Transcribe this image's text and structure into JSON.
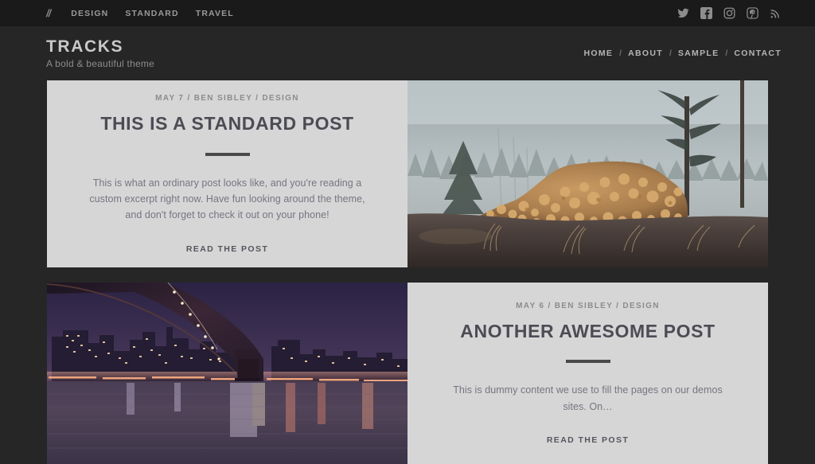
{
  "topbar": {
    "logo_mark": "//",
    "categories": [
      {
        "label": "DESIGN"
      },
      {
        "label": "STANDARD"
      },
      {
        "label": "TRAVEL"
      }
    ],
    "social": [
      {
        "name": "twitter-icon",
        "label": "Twitter"
      },
      {
        "name": "facebook-icon",
        "label": "Facebook"
      },
      {
        "name": "instagram-icon",
        "label": "Instagram"
      },
      {
        "name": "pinterest-icon",
        "label": "Pinterest"
      },
      {
        "name": "rss-icon",
        "label": "RSS"
      }
    ],
    "background": "#1a1a1a"
  },
  "header": {
    "site_title": "TRACKS",
    "tagline": "A bold & beautiful theme",
    "background": "#262626",
    "nav": [
      {
        "label": "HOME"
      },
      {
        "label": "ABOUT"
      },
      {
        "label": "SAMPLE"
      },
      {
        "label": "CONTACT"
      }
    ],
    "nav_separator": "/"
  },
  "posts": [
    {
      "meta": "MAY 7 / BEN SIBLEY / DESIGN",
      "date": "MAY 7",
      "author": "BEN SIBLEY",
      "category": "DESIGN",
      "title": "THIS IS A STANDARD POST",
      "excerpt": "This is what an ordinary post looks like, and you're reading a custom excerpt right now. Have fun looking around the theme, and don't forget to check it out on your phone!",
      "read_more": "READ THE POST",
      "image_alt": "Misty forest clearing with a large pile of cut logs",
      "layout": "text-left"
    },
    {
      "meta": "MAY 6 / BEN SIBLEY / DESIGN",
      "date": "MAY 6",
      "author": "BEN SIBLEY",
      "category": "DESIGN",
      "title": "ANOTHER AWESOME POST",
      "excerpt": "This is dummy content we use to fill the pages on our demos sites. On…",
      "read_more": "READ THE POST",
      "image_alt": "Brooklyn Bridge at night over the river with the city skyline lit up",
      "layout": "image-left"
    }
  ],
  "theme": {
    "page_background": "#262626",
    "card_background": "#d6d6d6",
    "title_color": "#4c4c55",
    "body_text_color": "#757580",
    "meta_color": "#8c8c8c",
    "rule_color": "#4a4a4a"
  }
}
